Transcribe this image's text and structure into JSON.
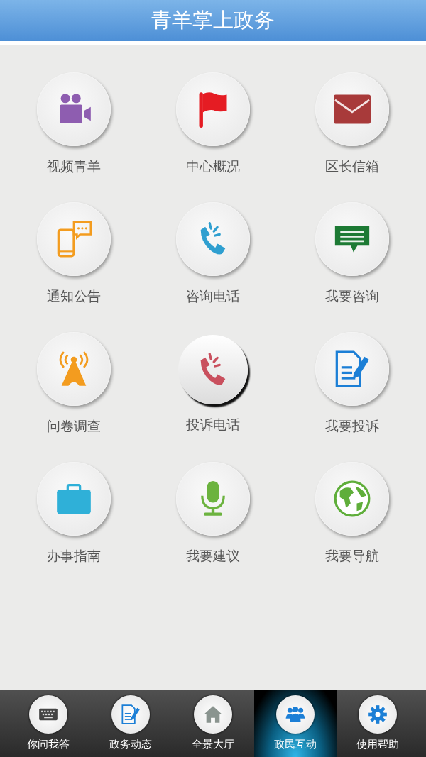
{
  "header": {
    "title": "青羊掌上政务"
  },
  "tiles": [
    {
      "label": "视频青羊",
      "kind": "video",
      "pressed": false
    },
    {
      "label": "中心概况",
      "kind": "flag",
      "pressed": false
    },
    {
      "label": "区长信箱",
      "kind": "mail",
      "pressed": false
    },
    {
      "label": "通知公告",
      "kind": "phone-chat",
      "pressed": false
    },
    {
      "label": "咨询电话",
      "kind": "call",
      "pressed": false
    },
    {
      "label": "我要咨询",
      "kind": "message",
      "pressed": false
    },
    {
      "label": "问卷调查",
      "kind": "tower",
      "pressed": false
    },
    {
      "label": "投诉电话",
      "kind": "call-red",
      "pressed": true
    },
    {
      "label": "我要投诉",
      "kind": "document",
      "pressed": false
    },
    {
      "label": "办事指南",
      "kind": "briefcase",
      "pressed": false
    },
    {
      "label": "我要建议",
      "kind": "microphone",
      "pressed": false
    },
    {
      "label": "我要导航",
      "kind": "globe",
      "pressed": false
    }
  ],
  "tabbar": [
    {
      "label": "你问我答",
      "kind": "keyboard",
      "selected": false
    },
    {
      "label": "政务动态",
      "kind": "document",
      "selected": false
    },
    {
      "label": "全景大厅",
      "kind": "home",
      "selected": false
    },
    {
      "label": "政民互动",
      "kind": "people",
      "selected": true
    },
    {
      "label": "使用帮助",
      "kind": "gear",
      "selected": false
    }
  ]
}
